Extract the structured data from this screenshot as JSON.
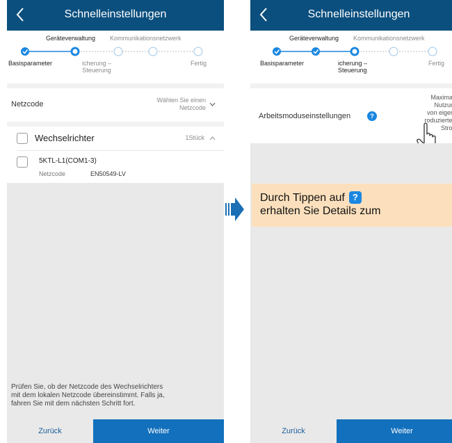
{
  "left": {
    "title": "Schnelleinstellungen",
    "steps": {
      "top_label_1": "Geräteverwaltung",
      "top_label_2": "Kommunikationsnetzwerk",
      "bottom_label_1": "Basisparameter",
      "bottom_label_2": "icherung –\nSteuerung",
      "bottom_label_3": "Fertig"
    },
    "netzcode_label": "Netzcode",
    "netzcode_placeholder": "Wählen Sie einen\nNetzcode",
    "group_title": "Wechselrichter",
    "group_count": "1Stück",
    "device_name": "5KTL-L1(COM1-3)",
    "device_field_label": "Netzcode",
    "device_field_value": "EN50549-LV",
    "footer_note": "Prüfen Sie, ob der Netzcode des Wechselrichters\nmit dem lokalen Netzcode übereinstimmt. Falls ja,\nfahren Sie mit dem nächsten Schritt fort.",
    "back_label": "Zurück",
    "next_label": "Weiter"
  },
  "right": {
    "title": "Schnelleinstellungen",
    "steps": {
      "top_label_1": "Geräteverwaltung",
      "top_label_2": "Kommunikationsnetzwerk",
      "bottom_label_1": "Basisparameter",
      "bottom_label_2": "icherung –\nSteuerung",
      "bottom_label_3": "Fertig"
    },
    "mode_label": "Arbeitsmoduseinstellungen",
    "mode_value": "Maximale\nNutzung\nvon eigenp\nroduziertem\nStrom",
    "back_label": "Zurück",
    "next_label": "Weiter"
  },
  "callout": {
    "line1": "Durch Tippen auf",
    "line2": "erhalten Sie Details zum",
    "badge": "?"
  },
  "colors": {
    "titlebar": "#0b4f7e",
    "accent": "#1270bd",
    "step_done": "#1a87e0",
    "callout_bg": "#fce0bd"
  },
  "icons": [
    "back-arrow-icon",
    "chevron-down-icon",
    "chevron-up-icon",
    "help-icon",
    "hand-pointer-icon",
    "arrow-right-icon",
    "checkbox"
  ]
}
